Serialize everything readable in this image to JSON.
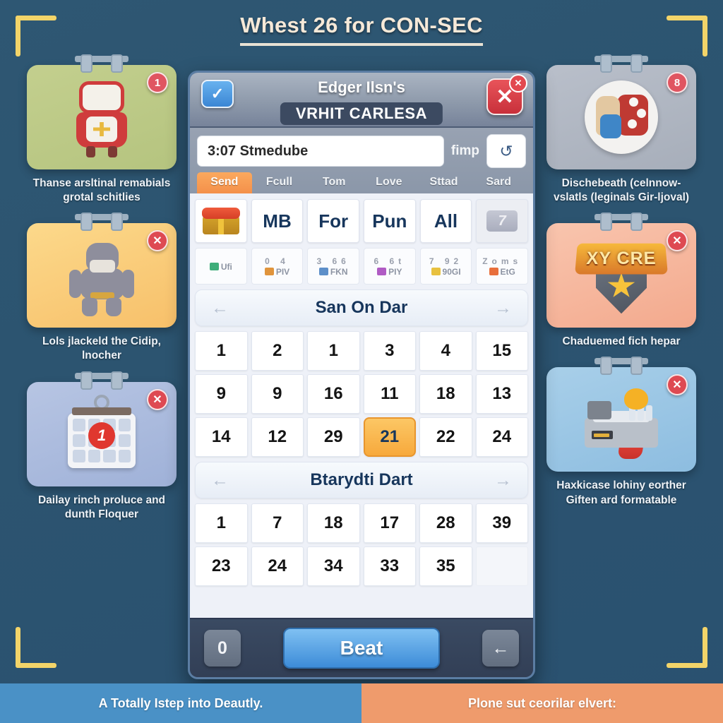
{
  "page": {
    "title": "Whest 26 for CON-SEC"
  },
  "left_cards": [
    {
      "art": "hero-knight-icon",
      "badge": "1",
      "badge_type": "num",
      "caption": "Thanse arsltinal remabials grotal schitlies"
    },
    {
      "art": "giant-character-icon",
      "badge": "✕",
      "badge_type": "x",
      "caption": "Lols jlackeld the Cidip, lnocher"
    },
    {
      "art": "calendar-icon",
      "badge": "✕",
      "badge_type": "x",
      "caption": "Dailay rinch proluce and dunth Floquer"
    }
  ],
  "right_cards": [
    {
      "art": "dice-characters-icon",
      "badge": "8",
      "badge_type": "num",
      "caption": "Dischebeath (celnnow-vslatls (leginals Gir-ljoval)"
    },
    {
      "art": "xycre-emblem-icon",
      "badge": "✕",
      "badge_type": "x",
      "emblem_text": "XY CRE",
      "caption": "Chaduemed fich hepar"
    },
    {
      "art": "factory-building-icon",
      "badge": "✕",
      "badge_type": "x",
      "caption": "Haxkicase lohiny eorther Giften ard formatable"
    }
  ],
  "dialog": {
    "check_button": "✓",
    "owner_title": "Edger Ilsn's",
    "subtitle": "VRHIT CARLESA",
    "close_button": "✕",
    "close_badge": "✕",
    "search": {
      "value": "3:07 Stmedube",
      "placeholder": "3:07 Stmedube",
      "side_label": "fimp",
      "refresh_icon": "↺"
    },
    "tabs": [
      {
        "label": "Send",
        "active": true
      },
      {
        "label": "Fcull",
        "active": false
      },
      {
        "label": "Tom",
        "active": false
      },
      {
        "label": "Love",
        "active": false
      },
      {
        "label": "Sttad",
        "active": false
      },
      {
        "label": "Sard",
        "active": false
      }
    ],
    "chips": [
      {
        "label": "",
        "icon": "gift-box-icon",
        "disabled": false
      },
      {
        "label": "MB",
        "icon": "",
        "disabled": false
      },
      {
        "label": "For",
        "icon": "",
        "disabled": false
      },
      {
        "label": "Pun",
        "icon": "",
        "disabled": false
      },
      {
        "label": "All",
        "icon": "",
        "disabled": false
      },
      {
        "label": "7",
        "icon": "",
        "disabled": true
      }
    ],
    "mini_cells": [
      {
        "nums": "",
        "label": "Ufi",
        "color": "#3fae7a"
      },
      {
        "nums": "0  4",
        "label": "PIV",
        "color": "#e0943c"
      },
      {
        "nums": "3  66",
        "label": "FKN",
        "color": "#5d8fc9"
      },
      {
        "nums": "6  6t",
        "label": "PIY",
        "color": "#b05bc4"
      },
      {
        "nums": "7  92",
        "label": "90GI",
        "color": "#e8c13f"
      },
      {
        "nums": "Zoms",
        "label": "EtG",
        "color": "#e86f3c"
      }
    ],
    "sections": [
      {
        "title": "San On Dar",
        "prev_arrow": "←",
        "next_arrow": "→",
        "rows": [
          [
            {
              "value": "1",
              "selected": false
            },
            {
              "value": "2",
              "selected": false
            },
            {
              "value": "1",
              "selected": false
            },
            {
              "value": "3",
              "selected": false
            },
            {
              "value": "4",
              "selected": false
            },
            {
              "value": "15",
              "selected": false
            }
          ],
          [
            {
              "value": "9",
              "selected": false
            },
            {
              "value": "9",
              "selected": false
            },
            {
              "value": "16",
              "selected": false
            },
            {
              "value": "11",
              "selected": false
            },
            {
              "value": "18",
              "selected": false
            },
            {
              "value": "13",
              "selected": false
            }
          ],
          [
            {
              "value": "14",
              "selected": false
            },
            {
              "value": "12",
              "selected": false
            },
            {
              "value": "29",
              "selected": false
            },
            {
              "value": "21",
              "selected": true
            },
            {
              "value": "22",
              "selected": false
            },
            {
              "value": "24",
              "selected": false
            }
          ]
        ]
      },
      {
        "title": "Btarydti Dart",
        "prev_arrow": "←",
        "next_arrow": "→",
        "rows": [
          [
            {
              "value": "1",
              "selected": false
            },
            {
              "value": "7",
              "selected": false
            },
            {
              "value": "18",
              "selected": false
            },
            {
              "value": "17",
              "selected": false
            },
            {
              "value": "28",
              "selected": false
            },
            {
              "value": "39",
              "selected": false
            }
          ],
          [
            {
              "value": "23",
              "selected": false
            },
            {
              "value": "24",
              "selected": false
            },
            {
              "value": "34",
              "selected": false
            },
            {
              "value": "33",
              "selected": false
            },
            {
              "value": "35",
              "selected": false
            },
            {
              "value": "",
              "selected": false,
              "empty": true
            }
          ]
        ]
      }
    ],
    "footer": {
      "left_button": "0",
      "primary_button": "Beat",
      "back_button": "←"
    }
  },
  "bottom_bar": {
    "left_text": "A Totally Istep into Deautly.",
    "right_text": "Plone sut ceorilar elvert:"
  },
  "colors": {
    "background": "#2c5470",
    "accent_orange": "#f4904a",
    "accent_blue": "#3d8cd8",
    "danger_red": "#de4a52",
    "bracket_yellow": "#f3d469"
  }
}
